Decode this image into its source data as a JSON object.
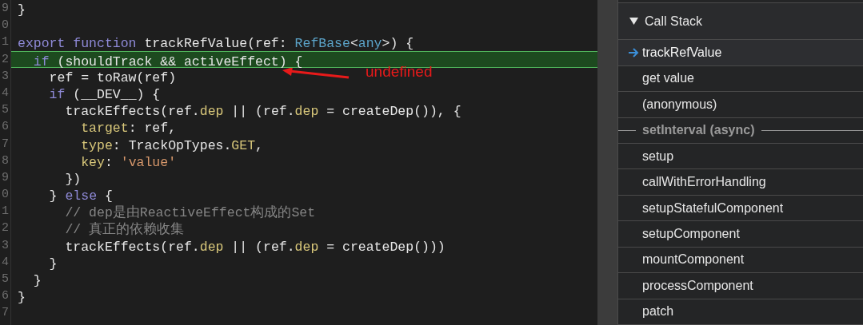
{
  "editor": {
    "lines": [
      {
        "number": "9",
        "highlighted": false,
        "tokens": [
          {
            "kind": "plain",
            "text": "}"
          }
        ]
      },
      {
        "number": "0",
        "highlighted": false
      },
      {
        "number": "1",
        "highlighted": false,
        "tokens": [
          {
            "kind": "keyword",
            "text": "export function "
          },
          {
            "kind": "plain",
            "text": "trackRefValue(ref: "
          },
          {
            "kind": "type",
            "text": "RefBase"
          },
          {
            "kind": "plain",
            "text": "<"
          },
          {
            "kind": "type",
            "text": "any"
          },
          {
            "kind": "plain",
            "text": ">) {"
          }
        ]
      },
      {
        "number": "2",
        "highlighted": true,
        "tokens": [
          {
            "kind": "keyword",
            "text": "  if"
          },
          {
            "kind": "plain",
            "text": " (shouldTrack && activeEffect) {"
          }
        ]
      },
      {
        "number": "3",
        "highlighted": false,
        "tokens": [
          {
            "kind": "plain",
            "text": "    ref = toRaw(ref)"
          }
        ]
      },
      {
        "number": "4",
        "highlighted": false,
        "tokens": [
          {
            "kind": "keyword",
            "text": "    if"
          },
          {
            "kind": "plain",
            "text": " (__DEV__) {"
          }
        ]
      },
      {
        "number": "5",
        "highlighted": false,
        "tokens": [
          {
            "kind": "plain",
            "text": "      trackEffects(ref."
          },
          {
            "kind": "property",
            "text": "dep"
          },
          {
            "kind": "plain",
            "text": " || (ref."
          },
          {
            "kind": "property",
            "text": "dep"
          },
          {
            "kind": "plain",
            "text": " = createDep()), {"
          }
        ]
      },
      {
        "number": "6",
        "highlighted": false,
        "tokens": [
          {
            "kind": "property",
            "text": "        target"
          },
          {
            "kind": "plain",
            "text": ": ref,"
          }
        ]
      },
      {
        "number": "7",
        "highlighted": false,
        "tokens": [
          {
            "kind": "property",
            "text": "        type"
          },
          {
            "kind": "plain",
            "text": ": TrackOpTypes."
          },
          {
            "kind": "property",
            "text": "GET"
          },
          {
            "kind": "plain",
            "text": ","
          }
        ]
      },
      {
        "number": "8",
        "highlighted": false,
        "tokens": [
          {
            "kind": "property",
            "text": "        key"
          },
          {
            "kind": "plain",
            "text": ": "
          },
          {
            "kind": "string",
            "text": "'value'"
          }
        ]
      },
      {
        "number": "9",
        "highlighted": false,
        "tokens": [
          {
            "kind": "plain",
            "text": "      })"
          }
        ]
      },
      {
        "number": "0",
        "highlighted": false,
        "tokens": [
          {
            "kind": "plain",
            "text": "    } "
          },
          {
            "kind": "keyword",
            "text": "else"
          },
          {
            "kind": "plain",
            "text": " {"
          }
        ]
      },
      {
        "number": "1",
        "highlighted": false,
        "tokens": [
          {
            "kind": "comment",
            "text": "      // dep是由ReactiveEffect构成的Set"
          }
        ]
      },
      {
        "number": "2",
        "highlighted": false,
        "tokens": [
          {
            "kind": "comment",
            "text": "      // 真正的依赖收集"
          }
        ]
      },
      {
        "number": "3",
        "highlighted": false,
        "tokens": [
          {
            "kind": "plain",
            "text": "      trackEffects(ref."
          },
          {
            "kind": "property",
            "text": "dep"
          },
          {
            "kind": "plain",
            "text": " || (ref."
          },
          {
            "kind": "property",
            "text": "dep"
          },
          {
            "kind": "plain",
            "text": " = createDep()))"
          }
        ]
      },
      {
        "number": "4",
        "highlighted": false,
        "tokens": [
          {
            "kind": "plain",
            "text": "    }"
          }
        ]
      },
      {
        "number": "5",
        "highlighted": false,
        "tokens": [
          {
            "kind": "plain",
            "text": "  }"
          }
        ]
      },
      {
        "number": "6",
        "highlighted": false,
        "tokens": [
          {
            "kind": "plain",
            "text": "}"
          }
        ]
      },
      {
        "number": "7",
        "highlighted": false
      }
    ],
    "annotation": {
      "text": "undefined"
    }
  },
  "call_stack": {
    "title": "Call Stack",
    "expanded": true,
    "frames": [
      {
        "kind": "frame",
        "name": "trackRefValue",
        "selected": true
      },
      {
        "kind": "frame",
        "name": "get value",
        "selected": false
      },
      {
        "kind": "frame",
        "name": "(anonymous)",
        "selected": false
      },
      {
        "kind": "async",
        "name": "setInterval (async)"
      },
      {
        "kind": "frame",
        "name": "setup",
        "selected": false
      },
      {
        "kind": "frame",
        "name": "callWithErrorHandling",
        "selected": false
      },
      {
        "kind": "frame",
        "name": "setupStatefulComponent",
        "selected": false
      },
      {
        "kind": "frame",
        "name": "setupComponent",
        "selected": false
      },
      {
        "kind": "frame",
        "name": "mountComponent",
        "selected": false
      },
      {
        "kind": "frame",
        "name": "processComponent",
        "selected": false
      },
      {
        "kind": "frame",
        "name": "patch",
        "selected": false
      }
    ]
  }
}
